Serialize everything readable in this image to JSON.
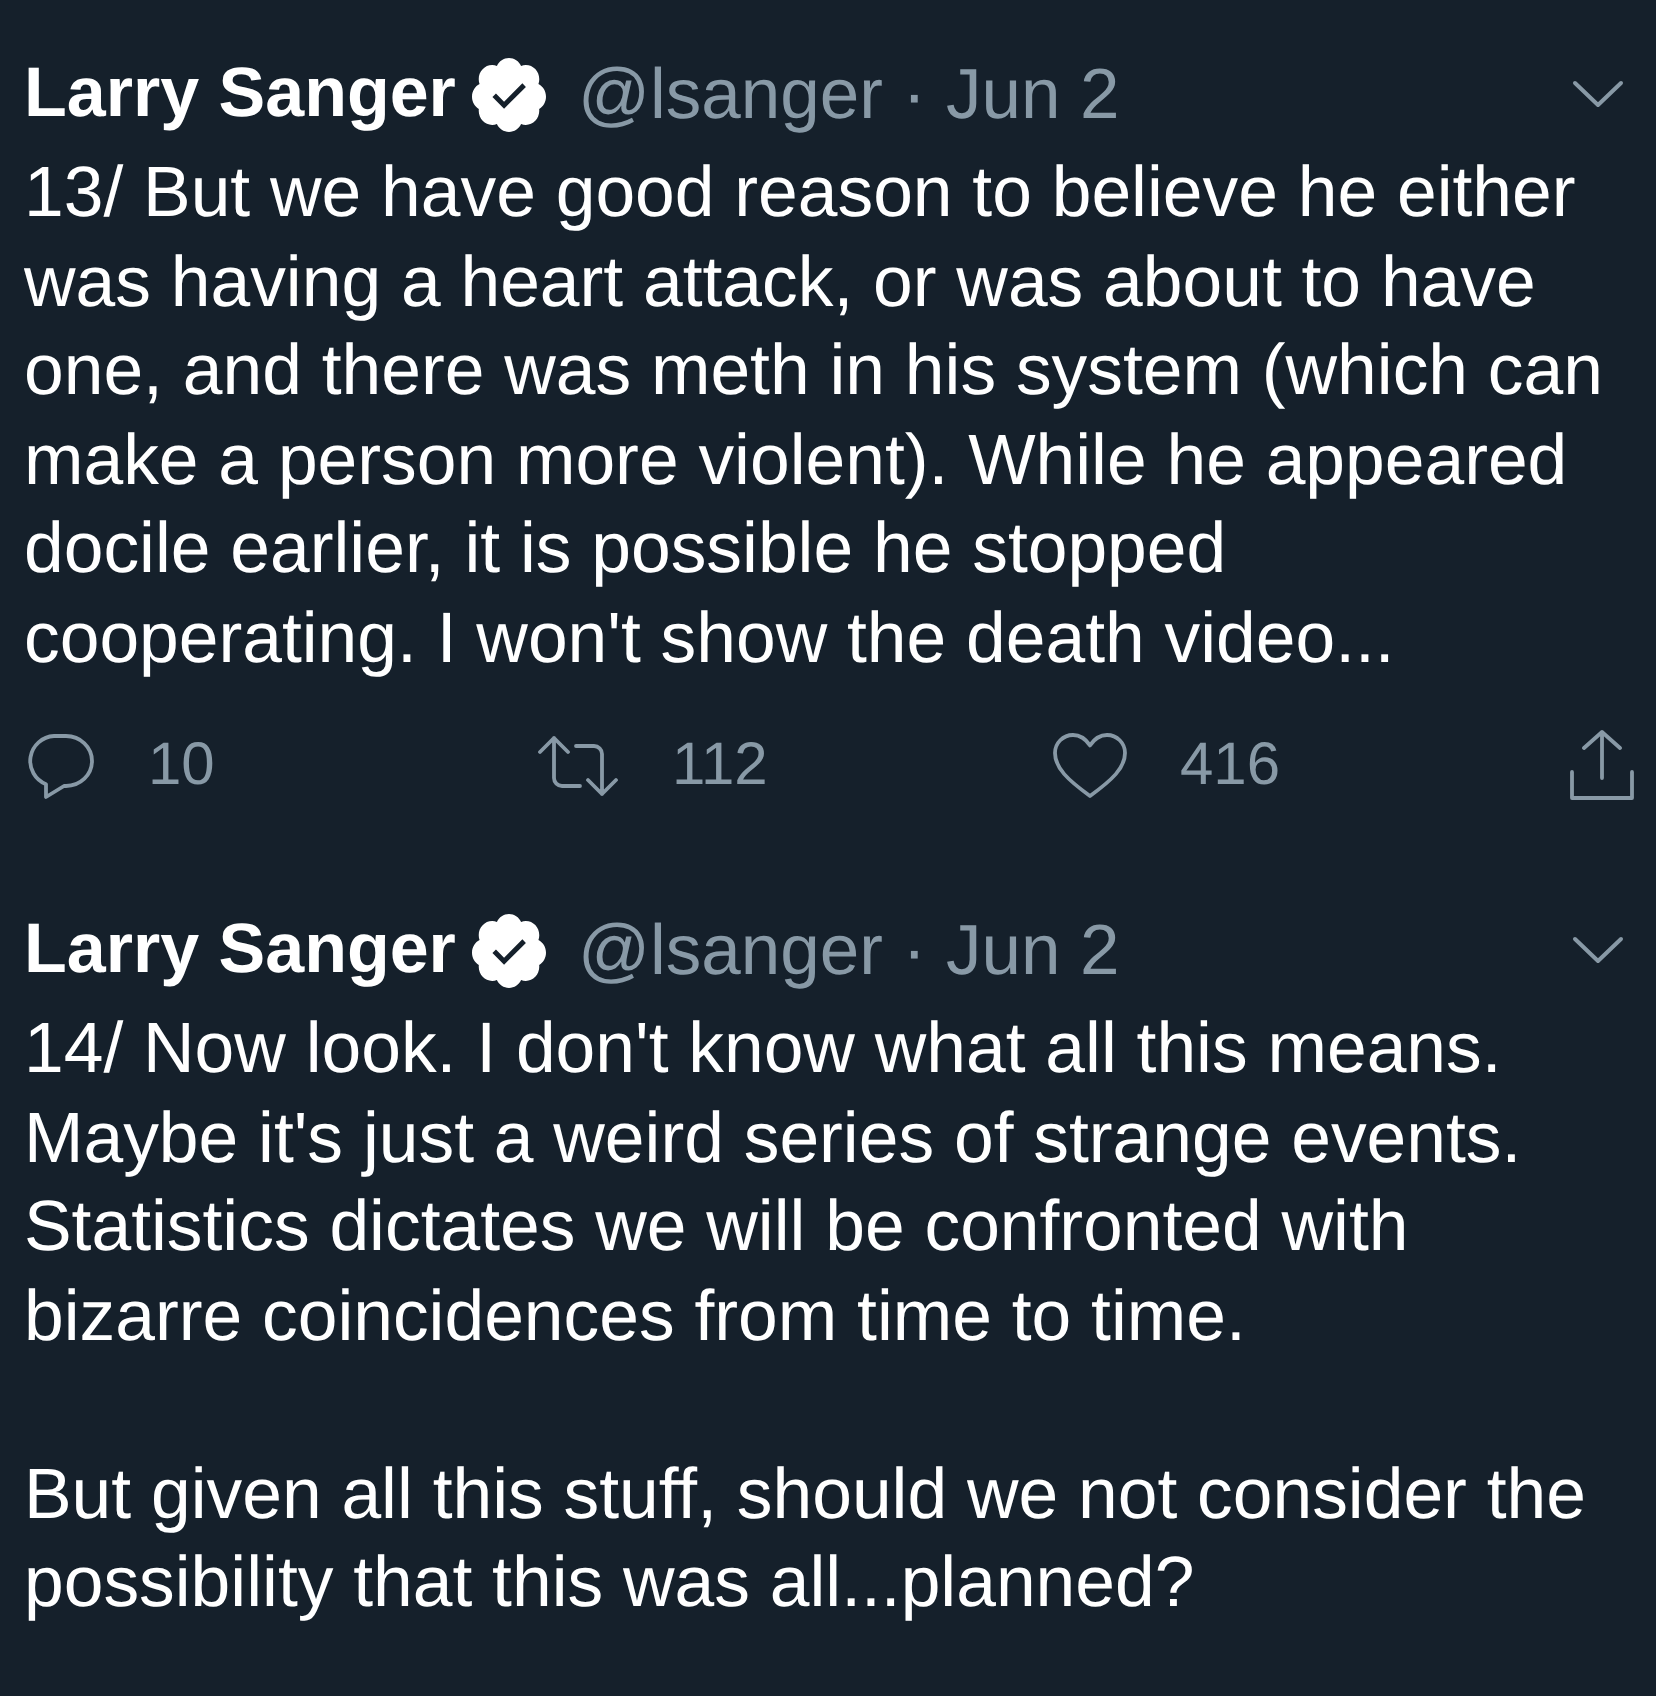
{
  "tweets": [
    {
      "author": {
        "name": "Larry Sanger",
        "verified": true
      },
      "meta": "@lsanger · Jun 2",
      "body": [
        "13/ But we have good reason to believe he either was having a heart attack, or was about to have one, and there was meth in his system (which can make a person more violent). While he appeared docile earlier, it is possible he stopped cooperating. I won't show the death video..."
      ],
      "actions": [
        {
          "kind": "reply",
          "count": "10"
        },
        {
          "kind": "retweet",
          "count": "112"
        },
        {
          "kind": "like",
          "count": "416"
        },
        {
          "kind": "share"
        }
      ]
    },
    {
      "author": {
        "name": "Larry Sanger",
        "verified": true
      },
      "meta": "@lsanger · Jun 2",
      "body": [
        "14/ Now look. I don't know what all this means. Maybe it's just a weird series of strange events. Statistics dictates we will be confronted with bizarre coincidences from time to time.",
        "But given all this stuff, should we not consider the possibility that this was all...planned?"
      ]
    }
  ]
}
